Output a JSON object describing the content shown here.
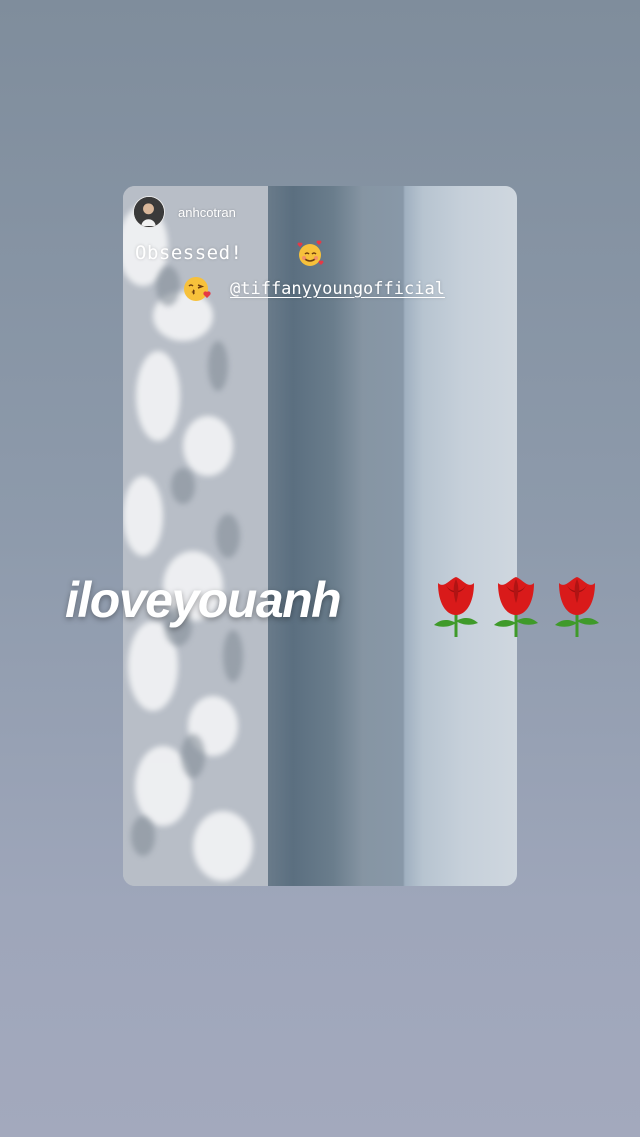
{
  "shared_post": {
    "username": "anhcotran",
    "caption": "Obsessed!",
    "mention": "@tiffanyyoungofficial",
    "emojis": [
      "smiling-face-with-hearts",
      "face-blowing-a-kiss"
    ]
  },
  "overlay": {
    "text": "iloveyouanh",
    "stickers": [
      "rose",
      "rose",
      "rose"
    ]
  },
  "colors": {
    "background_top": "#7f8d9c",
    "background_bottom": "#a3a9bd",
    "text": "#ffffff",
    "rose_red": "#d91a1a",
    "leaf_green": "#3f9a2a"
  }
}
